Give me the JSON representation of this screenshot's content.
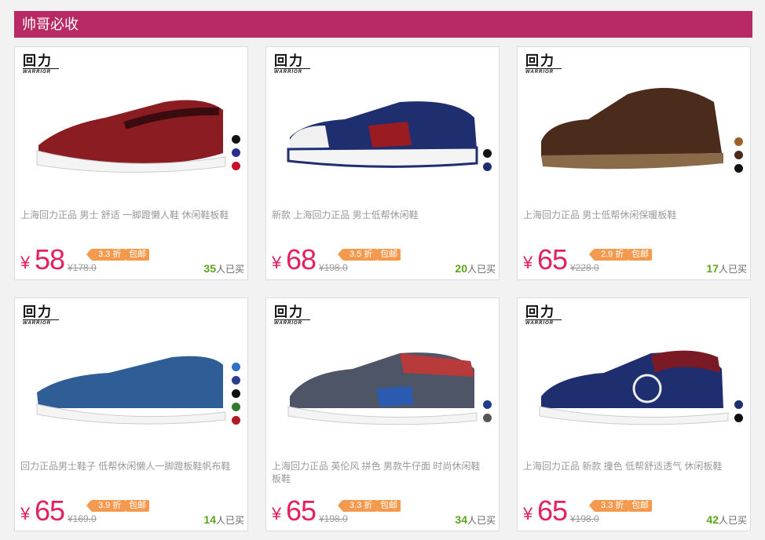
{
  "section": {
    "title": "帅哥必收"
  },
  "brand": {
    "cn": "回力",
    "en": "WARRIOR"
  },
  "colors": {
    "header": "#b82a64",
    "price": "#e4205f",
    "badge": "#f39a4e",
    "sold": "#5aa51b"
  },
  "products": [
    {
      "name": "上海回力正品 男士 舒适 一脚蹬懒人鞋 休闲鞋板鞋",
      "currency": "¥",
      "price": "58",
      "discount": "3.3 折",
      "shipping": "包邮",
      "original": "¥178.0",
      "sold_count": "35",
      "sold_suffix": "人已买",
      "swatches": [
        "#111111",
        "#2a2f8f",
        "#c8102e"
      ]
    },
    {
      "name": "新款 上海回力正品 男士低帮休闲鞋",
      "currency": "¥",
      "price": "68",
      "discount": "3.5 折",
      "shipping": "包邮",
      "original": "¥198.0",
      "sold_count": "20",
      "sold_suffix": "人已买",
      "swatches": [
        "#111111",
        "#1f2e6e"
      ]
    },
    {
      "name": "上海回力正品 男士低帮休闲保暖板鞋",
      "currency": "¥",
      "price": "65",
      "discount": "2.9 折",
      "shipping": "包邮",
      "original": "¥228.0",
      "sold_count": "17",
      "sold_suffix": "人已买",
      "swatches": [
        "#a0602a",
        "#4a2b1c",
        "#111111"
      ]
    },
    {
      "name": "回力正品男士鞋子 低帮休闲懒人一脚蹬板鞋帆布鞋",
      "currency": "¥",
      "price": "65",
      "discount": "3.9 折",
      "shipping": "包邮",
      "original": "¥169.0",
      "sold_count": "14",
      "sold_suffix": "人已买",
      "swatches": [
        "#2f6fc4",
        "#2c3f8c",
        "#111111",
        "#2f7a2f",
        "#b01a24"
      ]
    },
    {
      "name": "上海回力正品 英伦风 拼色 男款牛仔面 时尚休闲鞋 板鞋",
      "currency": "¥",
      "price": "65",
      "discount": "3.3 折",
      "shipping": "包邮",
      "original": "¥198.0",
      "sold_count": "34",
      "sold_suffix": "人已买",
      "swatches": [
        "#1f3c8c",
        "#555555"
      ]
    },
    {
      "name": "上海回力正品 新款 撞色 低帮舒适透气 休闲板鞋",
      "currency": "¥",
      "price": "65",
      "discount": "3.3 折",
      "shipping": "包邮",
      "original": "¥198.0",
      "sold_count": "42",
      "sold_suffix": "人已买",
      "swatches": [
        "#1f2e6e",
        "#111111"
      ]
    }
  ]
}
